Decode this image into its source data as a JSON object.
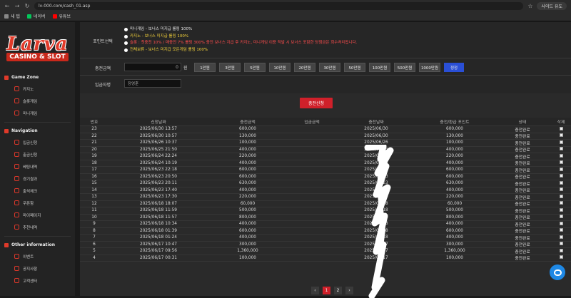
{
  "browser": {
    "url": "lv-000.com/cash_01.asp",
    "profile_label": "사이드 유도",
    "bookmarks": [
      "새 탭",
      "네이버",
      "유튜브"
    ]
  },
  "sidebar": {
    "logo_word": "Larva",
    "logo_sub": "CASINO & SLOT",
    "sections": [
      {
        "title": "Game Zone",
        "items": [
          "카지노",
          "슬롯게임",
          "미니게임"
        ]
      },
      {
        "title": "Navigation",
        "items": [
          "입금신청",
          "출금신청",
          "베팅내역",
          "경기결과",
          "출석체크",
          "쿠폰함",
          "마이페이지",
          "추천내역"
        ]
      },
      {
        "title": "Other information",
        "items": [
          "이벤트",
          "공지사항",
          "고객센터"
        ]
      }
    ]
  },
  "form": {
    "point_label": "포인트선택",
    "options": [
      {
        "text": "미니게임 - 보너스 미지급 롤링 100%",
        "color": "#e8e8e8"
      },
      {
        "text": "카지노 - 보너스 미지급 롤링 100%",
        "color": "#f5d33a"
      },
      {
        "text": "슬롯 : 첫충전 10% / 매충전 7% 롤링 300% 충전 보너스 지급 후 카지노, 미니게임 이용 적발 시 보너스 포함한 당첨금은 회수처리됩니다.",
        "color": "#ff4d4d"
      },
      {
        "text": "전체보류 - 보너스 미지급 모든게임 롤링 100%",
        "color": "#f5d33a"
      }
    ],
    "amount_label": "충전금액",
    "amount_value": "0",
    "won": "원",
    "amount_buttons": [
      "1만원",
      "3만원",
      "5만원",
      "10만원",
      "20만원",
      "30만원",
      "50만원",
      "100만원",
      "500만원",
      "1000만원"
    ],
    "reset_label": "정정",
    "depositor_label": "입금자명",
    "depositor_value": "장영훈",
    "submit_label": "충전신청"
  },
  "table": {
    "headers": [
      "번호",
      "신청날짜",
      "충전금액",
      "입금금액",
      "충전날짜",
      "충전/환급 포인트",
      "상태",
      "삭제"
    ],
    "rows": [
      [
        "23",
        "2025/06/30 13:57",
        "600,000",
        "2025/06/30",
        "600,000",
        "충전완료"
      ],
      [
        "22",
        "2025/06/30 10:57",
        "130,000",
        "2025/06/30",
        "130,000",
        "충전완료"
      ],
      [
        "21",
        "2025/06/26 10:37",
        "100,000",
        "2025/06/26",
        "100,000",
        "충전완료"
      ],
      [
        "20",
        "2025/06/25 21:50",
        "400,000",
        "2025/06/25",
        "400,000",
        "충전완료"
      ],
      [
        "19",
        "2025/06/24 22:24",
        "220,000",
        "2025/06/24",
        "220,000",
        "충전완료"
      ],
      [
        "18",
        "2025/06/24 10:19",
        "400,000",
        "2025/06/24",
        "400,000",
        "충전완료"
      ],
      [
        "17",
        "2025/06/23 22:18",
        "600,000",
        "2025/06/23",
        "600,000",
        "충전완료"
      ],
      [
        "16",
        "2025/06/23 20:50",
        "600,000",
        "2025/06/23",
        "600,000",
        "충전완료"
      ],
      [
        "15",
        "2025/06/23 20:11",
        "630,000",
        "2025/06/23",
        "630,000",
        "충전완료"
      ],
      [
        "14",
        "2025/06/23 17:40",
        "400,000",
        "2025/06/23",
        "400,000",
        "충전완료"
      ],
      [
        "13",
        "2025/06/23 17:30",
        "220,000",
        "2025/06/23",
        "220,000",
        "충전완료"
      ],
      [
        "12",
        "2025/06/18 18:07",
        "60,000",
        "2025/06/18",
        "60,000",
        "충전완료"
      ],
      [
        "11",
        "2025/06/18 11:59",
        "500,000",
        "2025/06/18",
        "500,000",
        "충전완료"
      ],
      [
        "10",
        "2025/06/18 11:57",
        "800,000",
        "2025/06/18",
        "800,000",
        "충전완료"
      ],
      [
        "9",
        "2025/06/18 10:34",
        "400,000",
        "2025/06/18",
        "400,000",
        "충전완료"
      ],
      [
        "8",
        "2025/06/18 01:39",
        "600,000",
        "2025/06/18",
        "600,000",
        "충전완료"
      ],
      [
        "7",
        "2025/06/18 01:24",
        "400,000",
        "2025/06/18",
        "400,000",
        "충전완료"
      ],
      [
        "6",
        "2025/06/17 10:47",
        "300,000",
        "2025/06/17",
        "300,000",
        "충전완료"
      ],
      [
        "5",
        "2025/06/17 09:56",
        "1,360,000",
        "2025/06/17",
        "1,360,000",
        "충전완료"
      ],
      [
        "4",
        "2025/06/17 00:31",
        "100,000",
        "2025/06/17",
        "100,000",
        "충전완료"
      ]
    ]
  },
  "pagination": {
    "prev": "‹",
    "pages": [
      "1",
      "2"
    ],
    "next": "›",
    "active": "1"
  }
}
